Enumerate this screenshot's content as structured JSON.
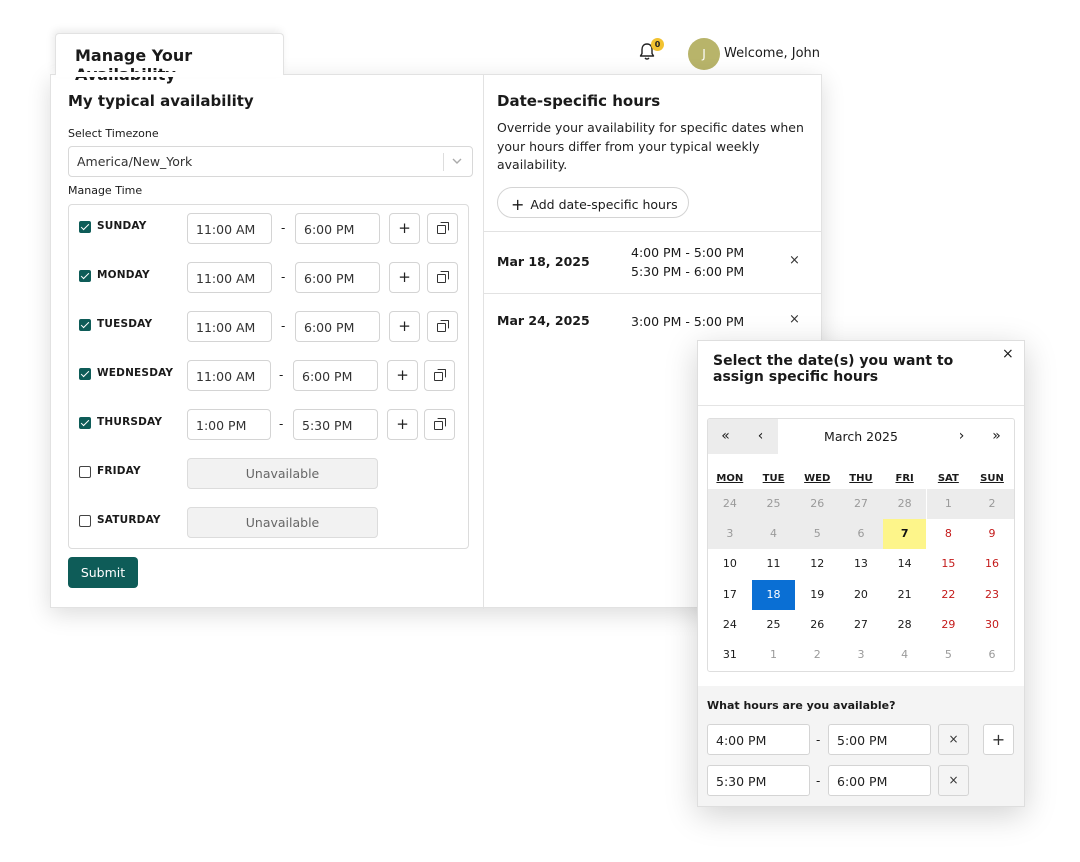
{
  "header": {
    "tab_title": "Manage Your Availability",
    "notification_count": "0",
    "avatar_initial": "J",
    "welcome": "Welcome, John"
  },
  "typical": {
    "heading": "My typical availability",
    "timezone_label": "Select Timezone",
    "timezone_value": "America/New_York",
    "manage_time_label": "Manage Time",
    "days": [
      {
        "name": "SUNDAY",
        "checked": true,
        "start": "11:00 AM",
        "end": "6:00 PM"
      },
      {
        "name": "MONDAY",
        "checked": true,
        "start": "11:00 AM",
        "end": "6:00 PM"
      },
      {
        "name": "TUESDAY",
        "checked": true,
        "start": "11:00 AM",
        "end": "6:00 PM"
      },
      {
        "name": "WEDNESDAY",
        "checked": true,
        "start": "11:00 AM",
        "end": "6:00 PM"
      },
      {
        "name": "THURSDAY",
        "checked": true,
        "start": "1:00 PM",
        "end": "5:30 PM"
      },
      {
        "name": "FRIDAY",
        "checked": false,
        "status": "Unavailable"
      },
      {
        "name": "SATURDAY",
        "checked": false,
        "status": "Unavailable"
      }
    ],
    "dash": "-",
    "add_symbol": "+",
    "submit_label": "Submit"
  },
  "date_specific": {
    "heading": "Date-specific hours",
    "description": "Override your availability for specific dates when your hours differ from your typical weekly availability.",
    "add_button": "Add date-specific hours",
    "add_symbol": "+",
    "remove_symbol": "×",
    "entries": [
      {
        "date": "Mar 18, 2025",
        "times": [
          "4:00 PM - 5:00 PM",
          "5:30 PM - 6:00 PM"
        ]
      },
      {
        "date": "Mar 24, 2025",
        "times": [
          "3:00 PM - 5:00 PM"
        ]
      }
    ]
  },
  "popup": {
    "title": "Select the date(s) you want to assign specific hours",
    "close_symbol": "×",
    "calendar": {
      "month_label": "March 2025",
      "nav": {
        "prev_year": "«",
        "prev_month": "‹",
        "next_month": "›",
        "next_year": "»"
      },
      "weekdays": [
        "MON",
        "TUE",
        "WED",
        "THU",
        "FRI",
        "SAT",
        "SUN"
      ],
      "weeks": [
        [
          "24",
          "25",
          "26",
          "27",
          "28",
          "1",
          "2"
        ],
        [
          "3",
          "4",
          "5",
          "6",
          "7",
          "8",
          "9"
        ],
        [
          "10",
          "11",
          "12",
          "13",
          "14",
          "15",
          "16"
        ],
        [
          "17",
          "18",
          "19",
          "20",
          "21",
          "22",
          "23"
        ],
        [
          "24",
          "25",
          "26",
          "27",
          "28",
          "29",
          "30"
        ],
        [
          "31",
          "1",
          "2",
          "3",
          "4",
          "5",
          "6"
        ]
      ],
      "today": "7",
      "selected": "18",
      "colors": {
        "today": "#fdf58a",
        "selected": "#0a6fd4",
        "weekend": "#c41a1a"
      }
    },
    "hours_question": "What hours are you available?",
    "slots": [
      {
        "start": "4:00 PM",
        "end": "5:00 PM"
      },
      {
        "start": "5:30 PM",
        "end": "6:00 PM"
      }
    ],
    "dash": "-",
    "remove_symbol": "×",
    "add_symbol": "+"
  },
  "colors": {
    "primary": "#0e5c58",
    "badge": "#f2c230",
    "avatar": "#b8b46a"
  }
}
